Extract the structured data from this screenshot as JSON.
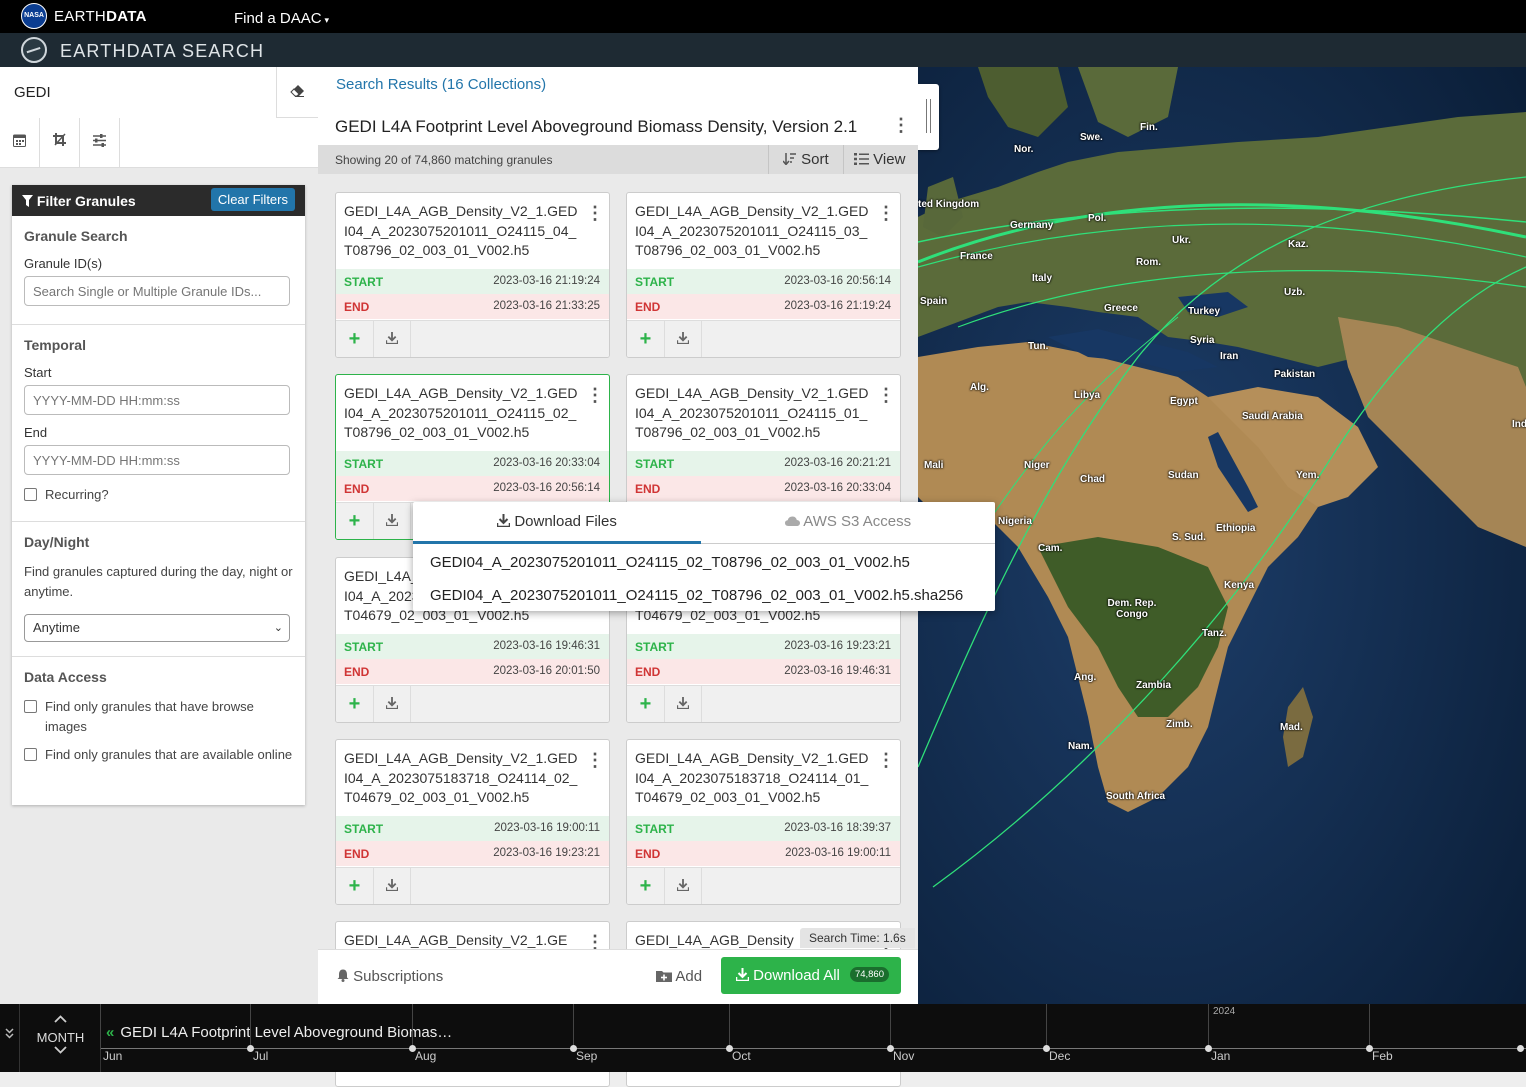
{
  "nasa_bar": {
    "logo_text": "NASA",
    "brand_prefix": "EARTH",
    "brand_suffix": "DATA",
    "find_daac": "Find a DAAC"
  },
  "app": {
    "title": "EARTHDATA SEARCH"
  },
  "search": {
    "value": "GEDI"
  },
  "filters": {
    "heading": "Filter Granules",
    "clear_label": "Clear Filters",
    "granule_search_title": "Granule Search",
    "granule_ids_label": "Granule ID(s)",
    "granule_ids_placeholder": "Search Single or Multiple Granule IDs...",
    "temporal_title": "Temporal",
    "start_label": "Start",
    "start_placeholder": "YYYY-MM-DD HH:mm:ss",
    "end_label": "End",
    "end_placeholder": "YYYY-MM-DD HH:mm:ss",
    "recurring_label": "Recurring?",
    "daynight_title": "Day/Night",
    "daynight_help": "Find granules captured during the day, night or anytime.",
    "daynight_value": "Anytime",
    "data_access_title": "Data Access",
    "browse_label": "Find only granules that have browse images",
    "online_label": "Find only granules that are available online"
  },
  "results": {
    "link": "Search Results (16 Collections)",
    "collection_title": "GEDI L4A Footprint Level Aboveground Biomass Density, Version 2.1",
    "showing": "Showing 20 of 74,860 matching granules",
    "sort_label": "Sort",
    "view_label": "View",
    "start_label": "START",
    "end_label": "END",
    "granules": [
      {
        "name": "GEDI_L4A_AGB_Density_V2_1.GEDI04_A_2023075201011_O24115_04_T08796_02_003_01_V002.h5",
        "start": "2023-03-16 21:19:24",
        "end": "2023-03-16 21:33:25"
      },
      {
        "name": "GEDI_L4A_AGB_Density_V2_1.GEDI04_A_2023075201011_O24115_03_T08796_02_003_01_V002.h5",
        "start": "2023-03-16 20:56:14",
        "end": "2023-03-16 21:19:24"
      },
      {
        "name": "GEDI_L4A_AGB_Density_V2_1.GEDI04_A_2023075201011_O24115_02_T08796_02_003_01_V002.h5",
        "start": "2023-03-16 20:33:04",
        "end": "2023-03-16 20:56:14"
      },
      {
        "name": "GEDI_L4A_AGB_Density_V2_1.GEDI04_A_2023075201011_O24115_01_T08796_02_003_01_V002.h5",
        "start": "2023-03-16 20:21:21",
        "end": "2023-03-16 20:33:04"
      },
      {
        "name": "GEDI_L4A_AGB_Density_V2_1.GEDI04_A_2023075183718_O24114_04_T04679_02_003_01_V002.h5",
        "start": "2023-03-16 19:46:31",
        "end": "2023-03-16 20:01:50"
      },
      {
        "name": "GEDI_L4A_AGB_Density_V2_1.GEDI04_A_2023075183718_O24114_03_T04679_02_003_01_V002.h5",
        "start": "2023-03-16 19:23:21",
        "end": "2023-03-16 19:46:31"
      },
      {
        "name": "GEDI_L4A_AGB_Density_V2_1.GEDI04_A_2023075183718_O24114_02_T04679_02_003_01_V002.h5",
        "start": "2023-03-16 19:00:11",
        "end": "2023-03-16 19:23:21"
      },
      {
        "name": "GEDI_L4A_AGB_Density_V2_1.GEDI04_A_2023075183718_O24114_01_T04679_02_003_01_V002.h5",
        "start": "2023-03-16 18:39:37",
        "end": "2023-03-16 19:00:11"
      },
      {
        "name": "GEDI_L4A_AGB_Density_V2_1.GE"
      },
      {
        "name": "GEDI_L4A_AGB_Density"
      }
    ],
    "search_time": "Search Time: 1.6s",
    "subscriptions_label": "Subscriptions",
    "add_label": "Add",
    "download_all_label": "Download All",
    "download_all_count": "74,860"
  },
  "download_popover": {
    "tab_download": "Download Files",
    "tab_s3": "AWS S3 Access",
    "links": [
      "GEDI04_A_2023075201011_O24115_02_T08796_02_003_01_V002.h5",
      "GEDI04_A_2023075201011_O24115_02_T08796_02_003_01_V002.h5.sha256"
    ]
  },
  "map": {
    "labels": [
      "Fin.",
      "Swe.",
      "Nor.",
      "ted Kingdom",
      "Germany",
      "Pol.",
      "Ukr.",
      "Kaz.",
      "France",
      "Rom.",
      "Uzb.",
      "Spain",
      "Italy",
      "Greece",
      "Turkey",
      "Tun.",
      "Syria",
      "Iran",
      "Alg.",
      "Libya",
      "Egypt",
      "Pakistan",
      "Saudi Arabia",
      "Ind",
      "Mali",
      "Niger",
      "Chad",
      "Sudan",
      "Yem.",
      "Nigeria",
      "Ethiopia",
      "Cam.",
      "S. Sud.",
      "Kenya",
      "Dem. Rep. Congo",
      "Tanz.",
      "Ang.",
      "Zambia",
      "Mad.",
      "Zimb.",
      "Nam.",
      "South Africa"
    ]
  },
  "timeline": {
    "zoom_label": "MONTH",
    "collection_label": "GEDI L4A Footprint Level Aboveground Biomas…",
    "months": [
      "Jun",
      "Jul",
      "Aug",
      "Sep",
      "Oct",
      "Nov",
      "Dec",
      "Jan",
      "Feb"
    ],
    "year": "2024"
  }
}
